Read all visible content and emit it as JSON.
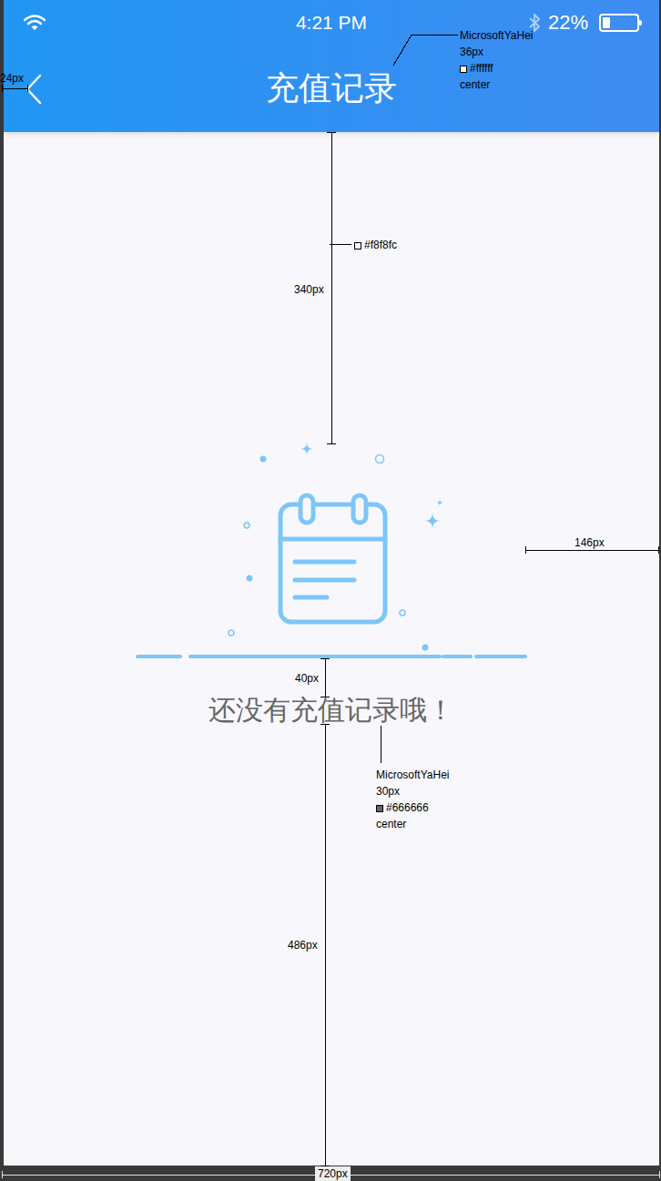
{
  "status_bar": {
    "time": "4:21 PM",
    "battery": "22%",
    "battery_level": 0.22
  },
  "nav_bar": {
    "title": "充值记录"
  },
  "empty_state": {
    "message": "还没有充值记录哦！"
  },
  "annotations": [
    {
      "kind": "dimension",
      "label": "24px"
    },
    {
      "kind": "spec",
      "lines": [
        "MicrosoftYaHei",
        "36px",
        "#ffffff",
        "center"
      ],
      "color": "#ffffff"
    },
    {
      "kind": "swatch",
      "label": "#f8f8fc",
      "color": "#f8f8fc"
    },
    {
      "kind": "dimension",
      "label": "340px"
    },
    {
      "kind": "dimension",
      "label": "146px"
    },
    {
      "kind": "dimension",
      "label": "40px"
    },
    {
      "kind": "spec",
      "lines": [
        "MicrosoftYaHei",
        "30px",
        "#666666",
        "center"
      ],
      "color": "#666666"
    },
    {
      "kind": "dimension",
      "label": "486px"
    },
    {
      "kind": "dimension",
      "label": "720px"
    }
  ]
}
